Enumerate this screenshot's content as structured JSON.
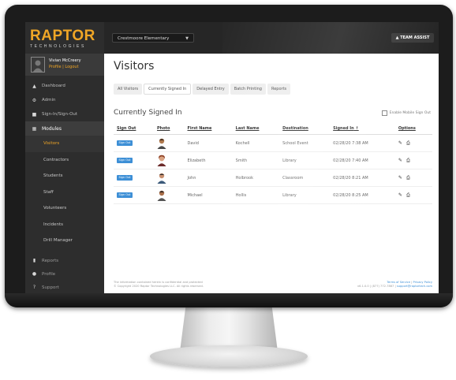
{
  "brand": {
    "name": "RAPTOR",
    "subtitle": "TECHNOLOGIES",
    "accent": "#f0a626"
  },
  "user": {
    "name": "Vivian McCreery",
    "profile_link": "Profile",
    "logout_link": "Logout"
  },
  "topbar": {
    "school": "Crestmoore Elementary",
    "team_assist": "TEAM ASSIST"
  },
  "nav": {
    "top_items": [
      {
        "label": "Dashboard",
        "icon": "dashboard-icon"
      },
      {
        "label": "Admin",
        "icon": "gear-icon"
      },
      {
        "label": "Sign-In/Sign-Out",
        "icon": "car-icon"
      }
    ],
    "section": {
      "label": "Modules",
      "icon": "modules-icon"
    },
    "sub_items": [
      {
        "label": "Visitors",
        "active": true
      },
      {
        "label": "Contractors"
      },
      {
        "label": "Students"
      },
      {
        "label": "Staff"
      },
      {
        "label": "Volunteers"
      },
      {
        "label": "Incidents"
      },
      {
        "label": "Drill Manager"
      }
    ],
    "bottom_items": [
      {
        "label": "Reports",
        "icon": "reports-icon"
      },
      {
        "label": "Profile",
        "icon": "person-icon"
      },
      {
        "label": "Support",
        "icon": "help-icon"
      }
    ]
  },
  "page": {
    "title": "Visitors"
  },
  "tabs": [
    "All Visitors",
    "Currently Signed In",
    "Delayed Entry",
    "Batch Printing",
    "Reports"
  ],
  "active_tab": "Currently Signed In",
  "section_title": "Currently Signed In",
  "mobile_signout": "Enable Mobile Sign Out",
  "table": {
    "columns": [
      "Sign Out",
      "Photo",
      "First Name",
      "Last Name",
      "Destination",
      "Signed In",
      "Options"
    ],
    "signout_label": "Sign Out",
    "rows": [
      {
        "first": "David",
        "last": "Kochell",
        "destination": "School Event",
        "signed_in": "02/28/20 7:38 AM"
      },
      {
        "first": "Elizabeth",
        "last": "Smith",
        "destination": "Library",
        "signed_in": "02/28/20 7:40 AM"
      },
      {
        "first": "John",
        "last": "Holbrook",
        "destination": "Classroom",
        "signed_in": "02/28/20 8:21 AM"
      },
      {
        "first": "Michael",
        "last": "Hollis",
        "destination": "Library",
        "signed_in": "02/28/20 8:25 AM"
      }
    ]
  },
  "footer": {
    "left_line1": "The information contained herein is confidential and protected",
    "left_line2": "© Copyright 2020 Raptor Technologies LLC. All rights reserved.",
    "right_line1_a": "Terms of Service",
    "right_line1_b": "Privacy Policy",
    "right_line2_a": "v6.1.0.0",
    "right_line2_b": "(877) 772-7867",
    "right_line2_c": "support@raptortech.com"
  }
}
